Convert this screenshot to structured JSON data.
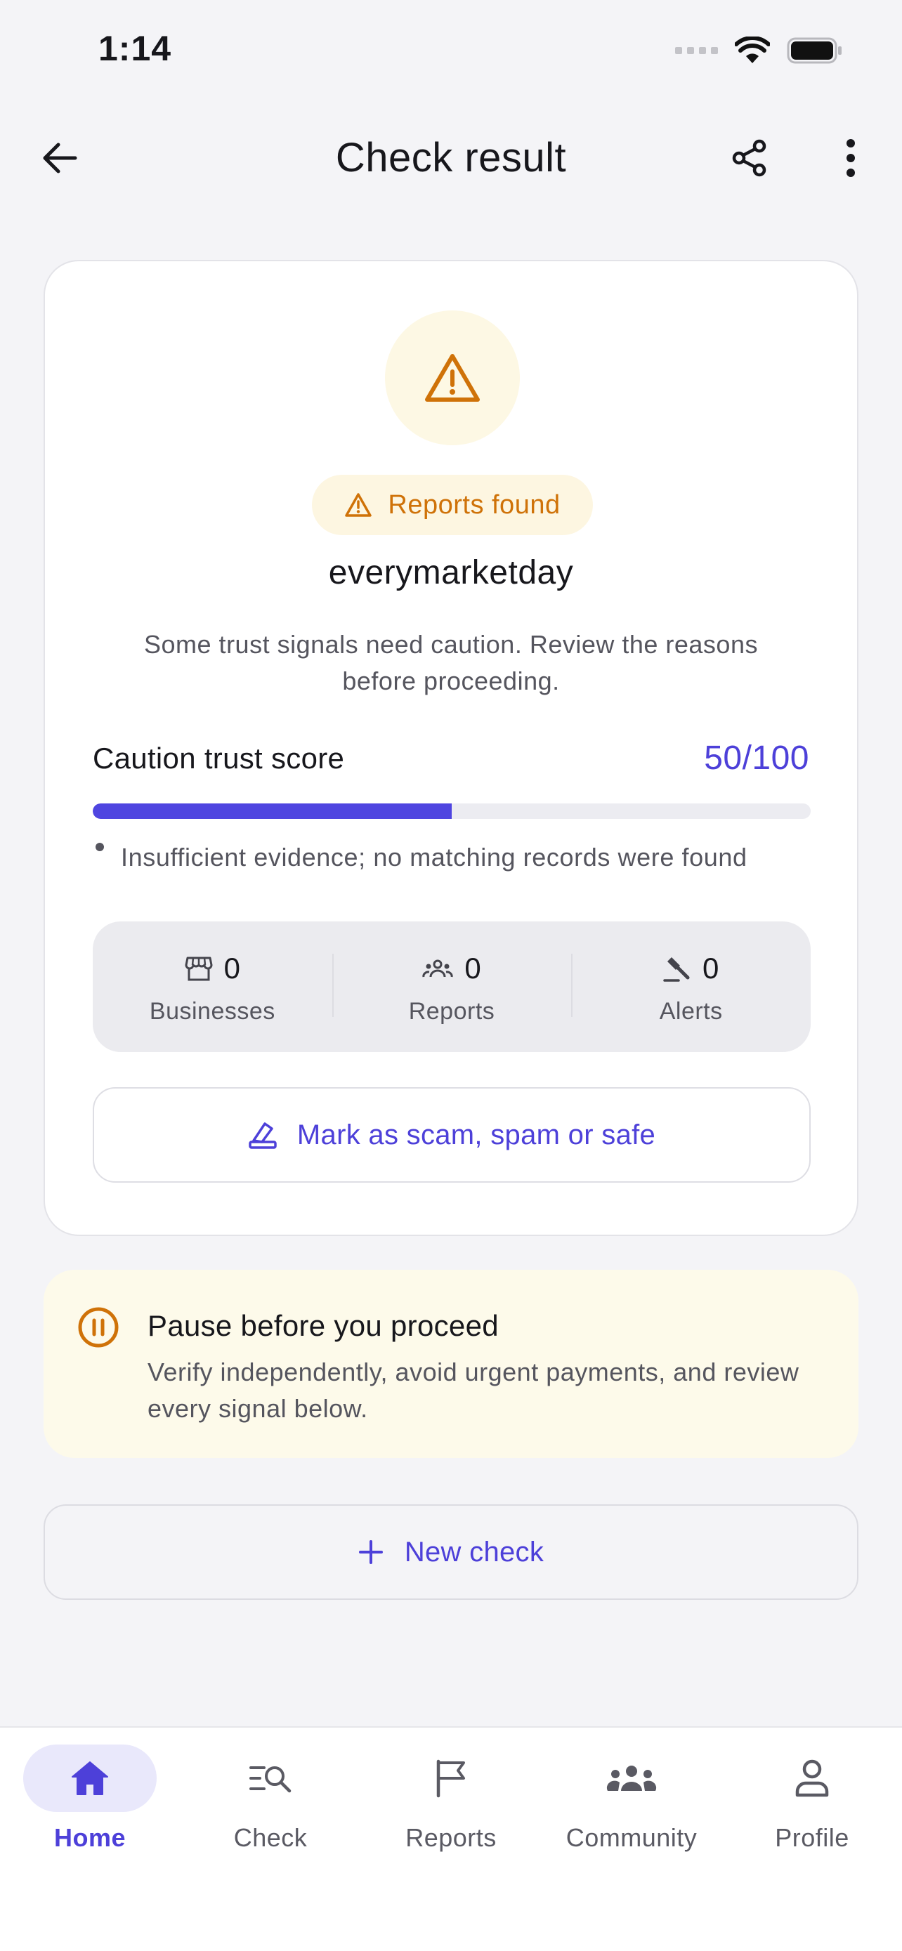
{
  "status_bar": {
    "time": "1:14"
  },
  "header": {
    "title": "Check result"
  },
  "result": {
    "badge_label": "Reports found",
    "entity_name": "everymarketday",
    "summary": "Some trust signals need caution. Review the reasons before proceeding.",
    "score_label": "Caution trust score",
    "score_display": "50/100",
    "score_fraction": 0.5,
    "evidence": "Insufficient evidence; no matching records were found",
    "stats": [
      {
        "icon": "storefront-icon",
        "count": "0",
        "label": "Businesses"
      },
      {
        "icon": "group-icon",
        "count": "0",
        "label": "Reports"
      },
      {
        "icon": "gavel-icon",
        "count": "0",
        "label": "Alerts"
      }
    ],
    "mark_button_label": "Mark as scam, spam or safe"
  },
  "pause": {
    "title": "Pause before you proceed",
    "body": "Verify independently, avoid urgent payments, and review every signal below."
  },
  "new_check_label": "New check",
  "nav": {
    "items": [
      {
        "label": "Home",
        "icon": "home-icon",
        "active": true
      },
      {
        "label": "Check",
        "icon": "search-list-icon",
        "active": false
      },
      {
        "label": "Reports",
        "icon": "flag-icon",
        "active": false
      },
      {
        "label": "Community",
        "icon": "community-icon",
        "active": false
      },
      {
        "label": "Profile",
        "icon": "person-icon",
        "active": false
      }
    ]
  },
  "colors": {
    "accent": "#4d40d9",
    "warning": "#cf7208",
    "warning_bg": "#fdf6e1",
    "background": "#f4f4f7"
  }
}
